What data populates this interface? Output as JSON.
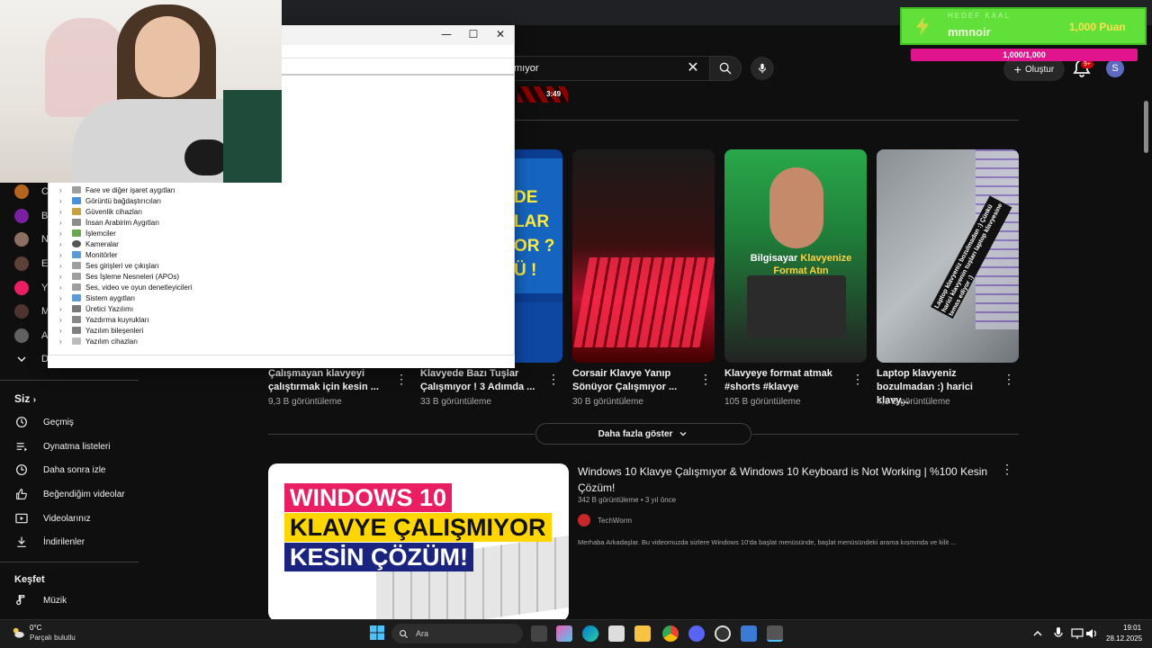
{
  "search": {
    "query_fragment": "mıyor"
  },
  "header": {
    "create_label": "Oluştur",
    "notification_badge": "9+",
    "avatar_initial": "S"
  },
  "overlay": {
    "title": "HEDEF KAAL",
    "name": "mmnoir",
    "points": "1,000 Puan",
    "bar_label": "1,000/1,000",
    "bar_progress": 1.0
  },
  "top_video": {
    "duration": "3:49"
  },
  "device_manager": {
    "tree_items": [
      "Fare ve diğer işaret aygıtları",
      "Görüntü bağdaştırıcıları",
      "Güvenlik cihazları",
      "İnsan Arabirim Aygıtları",
      "İşlemciler",
      "Kameralar",
      "Monitörler",
      "Ses girişleri ve çıkışları",
      "Ses İşleme Nesneleri (APOs)",
      "Ses, video ve oyun denetleyicileri",
      "Sistem aygıtları",
      "Üretici Yazılımı",
      "Yazdırma kuyrukları",
      "Yazılım bileşenleri",
      "Yazılım cihazları"
    ]
  },
  "sidebar": {
    "subscriptions": [
      {
        "initial": "C",
        "color": "#b5651d"
      },
      {
        "initial": "B",
        "color": "#7b1fa2"
      },
      {
        "initial": "N",
        "color": "#8d6e63"
      },
      {
        "initial": "E",
        "color": "#5d4037"
      },
      {
        "initial": "Y",
        "color": "#e91e63"
      },
      {
        "initial": "M",
        "color": "#4e342e"
      },
      {
        "initial": "A",
        "color": "#616161"
      },
      {
        "initial": "D",
        "color": "#0f0f0f"
      }
    ],
    "you_header": "Siz",
    "you_items": [
      "Geçmiş",
      "Oynatma listeleri",
      "Daha sonra izle",
      "Beğendiğim videolar",
      "Videolarınız",
      "İndirilenler"
    ],
    "explore_header": "Keşfet",
    "explore_items": [
      "Müzik"
    ]
  },
  "shorts": [
    {
      "title": "Çalışmayan klavyeyi çalıştırmak için kesin ...",
      "views": "9,3 B görüntüleme"
    },
    {
      "title": "Klavyede Bazı Tuşlar Çalışmıyor ! 3 Adımda ...",
      "views": "33 B görüntüleme"
    },
    {
      "title": "Corsair Klavye Yanıp Sönüyor Çalışmıyor ...",
      "views": "30 B görüntüleme"
    },
    {
      "title": "Klavyeye format atmak #shorts #klavye",
      "views": "105 B görüntüleme"
    },
    {
      "title": "Laptop klavyeniz bozulmadan :) harici klavy...",
      "views": "4,1 B görüntüleme"
    }
  ],
  "short_thumb_texts": {
    "s2_lines": [
      "DE",
      "LAR",
      "OR ?",
      "Ü !"
    ],
    "s4_line1_a": "Bilgisayar",
    "s4_line1_b": "Klavyenize",
    "s4_line2": "Format Atın",
    "s5_text": "Laptop klavyeniz bozulmadan :) Çünkü harici klavyenin tuşları laptop klavyesine temas ediyor :)"
  },
  "more_button": "Daha fazla göster",
  "video": {
    "title": "Windows 10 Klavye Çalışmıyor & Windows 10 Keyboard is Not Working | %100 Kesin Çözüm!",
    "meta": "342 B görüntüleme • 3 yıl önce",
    "channel": "TechWorm",
    "description": "Merhaba Arkadaşlar. Bu videomuzda sizlere Windows 10'da başlat menüsünde, başlat menüsündeki arama kısmında ve kilit ...",
    "thumb_line1": "WINDOWS 10",
    "thumb_line2": "KLAVYE ÇALIŞMIYOR",
    "thumb_line3": "KESİN ÇÖZÜM!"
  },
  "taskbar": {
    "weather_temp": "0°C",
    "weather_desc": "Parçalı bulutlu",
    "search_label": "Ara",
    "time": "19:01",
    "date": "28.12.2025"
  }
}
